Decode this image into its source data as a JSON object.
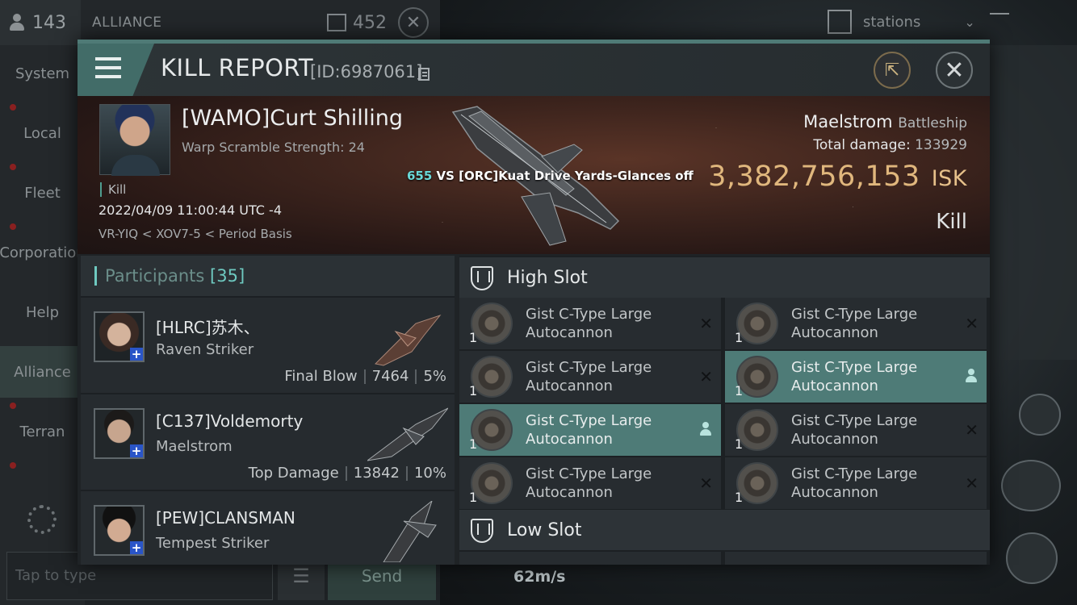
{
  "background": {
    "member_count": "143",
    "channel_name": "ALLIANCE",
    "message_count": "452",
    "sidebar": [
      "System",
      "Local",
      "Fleet",
      "Corporation",
      "Help",
      "Alliance",
      "Terran"
    ],
    "chat_placeholder": "Tap to type",
    "send_label": "Send",
    "stations_label": "stations",
    "speed": "62m/s"
  },
  "header": {
    "title": "KILL REPORT",
    "report_id": "[ID:6987061]"
  },
  "victim": {
    "name": "[WAMO]Curt Shilling",
    "subtitle": "Warp Scramble Strength: 24",
    "tag": "Kill",
    "datetime": "2022/04/09 11:00:44 UTC -4",
    "location": "VR-YIQ < XOV7-5 < Period Basis",
    "vs_number": "655",
    "vs_text": " VS [ORC]Kuat Drive Yards-Glances off",
    "ship_name": "Maelstrom",
    "ship_class": "Battleship",
    "total_damage_label": "Total damage:",
    "total_damage": "133929",
    "isk_value": "3,382,756,153",
    "isk_unit": "ISK",
    "result": "Kill"
  },
  "participants": {
    "title": "Participants",
    "count": "[35]",
    "rows": [
      {
        "name": "[HLRC]苏木、",
        "ship": "Raven Striker",
        "role": "Final Blow",
        "damage": "7464",
        "percent": "5%"
      },
      {
        "name": "[C137]Voldemorty",
        "ship": "Maelstrom",
        "role": "Top Damage",
        "damage": "13842",
        "percent": "10%"
      },
      {
        "name": "[PEW]CLANSMAN",
        "ship": "Tempest Striker",
        "role": "",
        "damage": "",
        "percent": ""
      }
    ]
  },
  "fittings": {
    "high_slot_title": "High Slot",
    "low_slot_title": "Low Slot",
    "high_slot": [
      {
        "qty": "1",
        "name": "Gist C-Type Large Autocannon",
        "status": "destroyed"
      },
      {
        "qty": "1",
        "name": "Gist C-Type Large Autocannon",
        "status": "destroyed"
      },
      {
        "qty": "1",
        "name": "Gist C-Type Large Autocannon",
        "status": "destroyed"
      },
      {
        "qty": "1",
        "name": "Gist C-Type Large Autocannon",
        "status": "dropped"
      },
      {
        "qty": "1",
        "name": "Gist C-Type Large Autocannon",
        "status": "dropped"
      },
      {
        "qty": "1",
        "name": "Gist C-Type Large Autocannon",
        "status": "destroyed"
      },
      {
        "qty": "1",
        "name": "Gist C-Type Large Autocannon",
        "status": "destroyed"
      },
      {
        "qty": "1",
        "name": "Gist C-Type Large Autocannon",
        "status": "destroyed"
      }
    ]
  },
  "colors": {
    "accent": "#4e7b77",
    "isk": "#e0b77d",
    "vs_number": "#6ad9d8"
  }
}
